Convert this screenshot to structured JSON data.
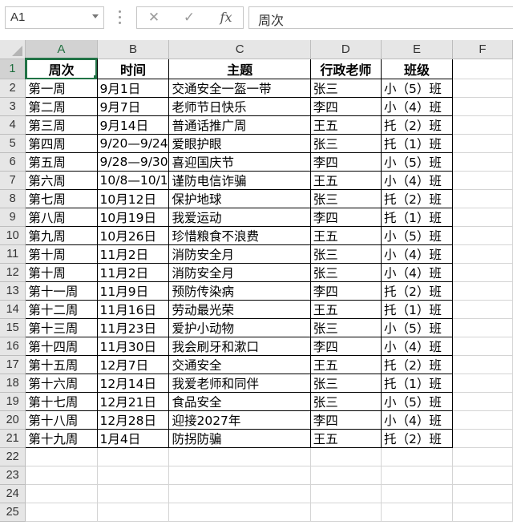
{
  "formula_bar": {
    "name_box": "A1",
    "cancel_icon": "✕",
    "enter_icon": "✓",
    "fx_label": "fx",
    "formula_value": "周次"
  },
  "columns": [
    "A",
    "B",
    "C",
    "D",
    "E",
    "F"
  ],
  "rows": [
    "1",
    "2",
    "3",
    "4",
    "5",
    "6",
    "7",
    "8",
    "9",
    "10",
    "11",
    "12",
    "13",
    "14",
    "15",
    "16",
    "17",
    "18",
    "19",
    "20",
    "21",
    "22",
    "23",
    "24",
    "25"
  ],
  "header": [
    "周次",
    "时间",
    "主题",
    "行政老师",
    "班级"
  ],
  "records": [
    [
      "第一周",
      "9月1日",
      "交通安全一盔一带",
      "张三",
      "小（5）班"
    ],
    [
      "第二周",
      "9月7日",
      "老师节日快乐",
      "李四",
      "小（4）班"
    ],
    [
      "第三周",
      "9月14日",
      "普通话推广周",
      "王五",
      "托（2）班"
    ],
    [
      "第四周",
      "9/20—9/24",
      "爱眼护眼",
      "张三",
      "托（1）班"
    ],
    [
      "第五周",
      "9/28—9/30",
      "喜迎国庆节",
      "李四",
      "小（5）班"
    ],
    [
      "第六周",
      "10/8—10/1",
      "谨防电信诈骗",
      "王五",
      "小（4）班"
    ],
    [
      "第七周",
      "10月12日",
      "保护地球",
      "张三",
      "托（2）班"
    ],
    [
      "第八周",
      "10月19日",
      "我爱运动",
      "李四",
      "托（1）班"
    ],
    [
      "第九周",
      "10月26日",
      "珍惜粮食不浪费",
      "王五",
      "小（5）班"
    ],
    [
      "第十周",
      "11月2日",
      "消防安全月",
      "张三",
      "小（4）班"
    ],
    [
      "第十周",
      "11月2日",
      "消防安全月",
      "张三",
      "小（4）班"
    ],
    [
      "第十一周",
      "11月9日",
      "预防传染病",
      "李四",
      "托（2）班"
    ],
    [
      "第十二周",
      "11月16日",
      "劳动最光荣",
      "王五",
      "托（1）班"
    ],
    [
      "第十三周",
      "11月23日",
      "爱护小动物",
      "张三",
      "小（5）班"
    ],
    [
      "第十四周",
      "11月30日",
      "我会刷牙和漱口",
      "李四",
      "小（4）班"
    ],
    [
      "第十五周",
      "12月7日",
      "交通安全",
      "王五",
      "托（2）班"
    ],
    [
      "第十六周",
      "12月14日",
      "我爱老师和同伴",
      "张三",
      "托（1）班"
    ],
    [
      "第十七周",
      "12月21日",
      "食品安全",
      "张三",
      "小（5）班"
    ],
    [
      "第十八周",
      "12月28日",
      "迎接2027年",
      "李四",
      "小（4）班"
    ],
    [
      "第十九周",
      "1月4日",
      "防拐防骗",
      "王五",
      "托（2）班"
    ]
  ]
}
